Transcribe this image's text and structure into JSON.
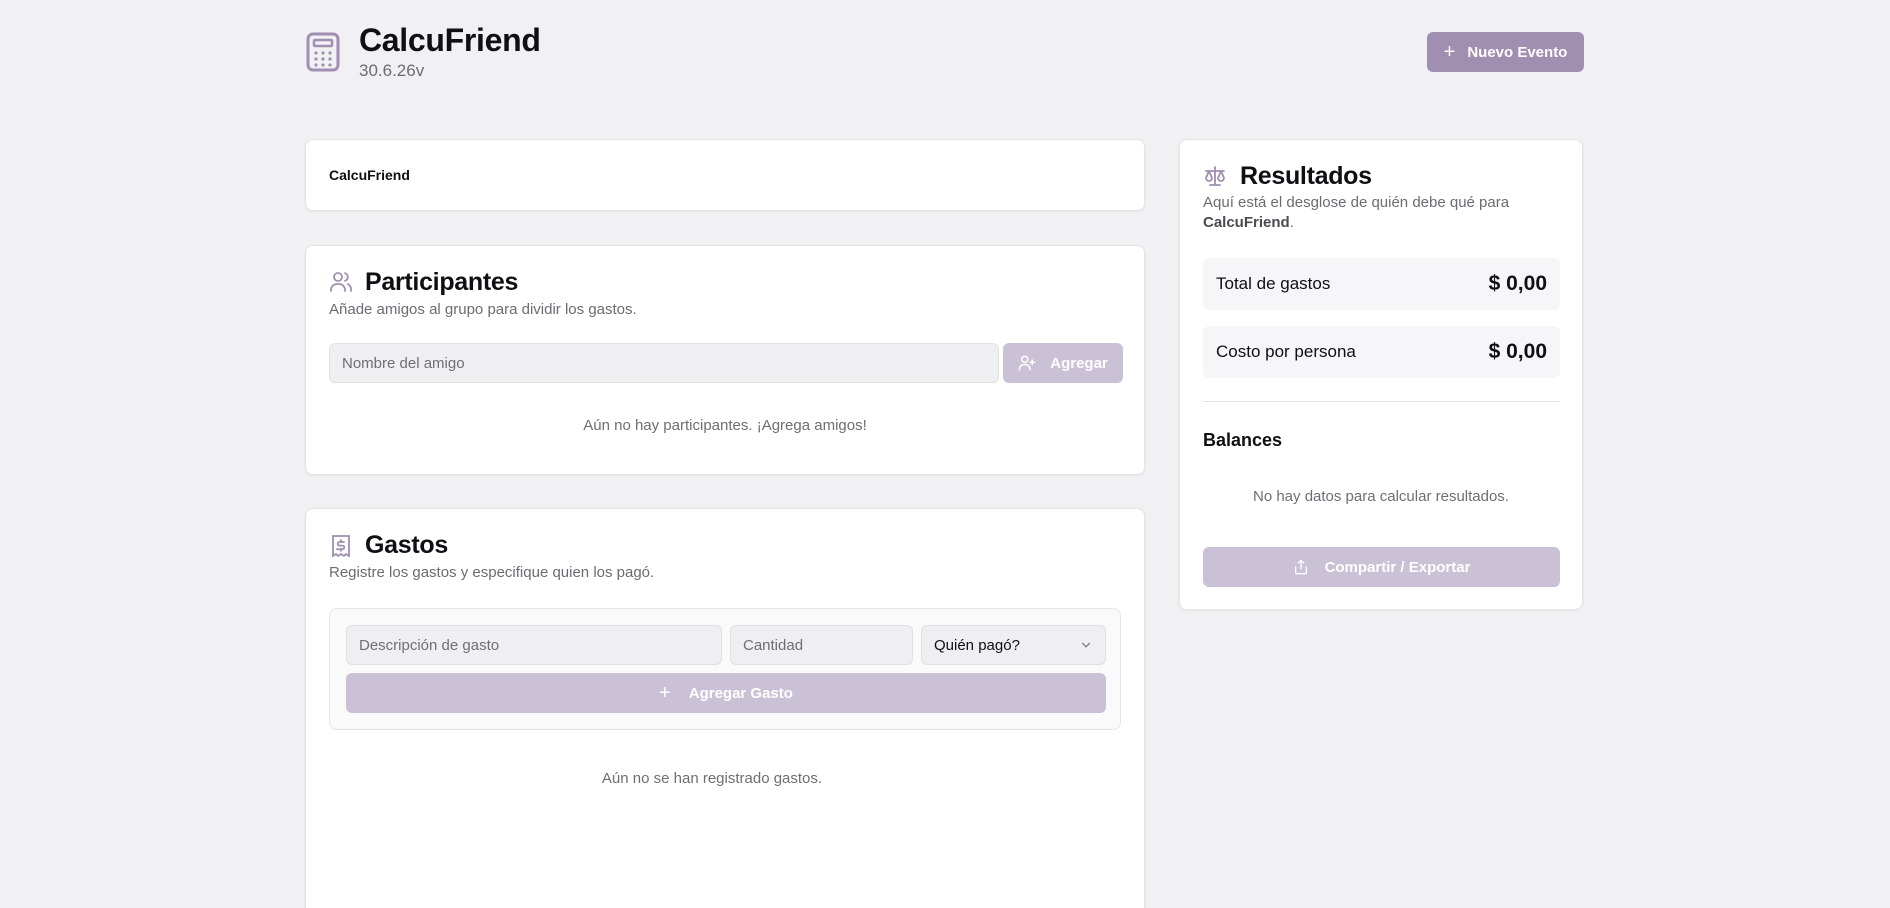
{
  "app": {
    "title": "CalcuFriend",
    "version": "30.6.26v",
    "new_event_label": "Nuevo Evento",
    "accent": "#a08fb0",
    "accent_disabled": "#cbc1d6"
  },
  "event": {
    "name": "CalcuFriend"
  },
  "participants": {
    "title": "Participantes",
    "subtitle": "Añade amigos al grupo para dividir los gastos.",
    "input_placeholder": "Nombre del amigo",
    "add_label": "Agregar",
    "empty": "Aún no hay participantes. ¡Agrega amigos!"
  },
  "expenses": {
    "title": "Gastos",
    "subtitle": "Registre los gastos y especifique quien los pagó.",
    "desc_placeholder": "Descripción de gasto",
    "qty_placeholder": "Cantidad",
    "payer_selected": "Quién pagó?",
    "add_label": "Agregar Gasto",
    "empty": "Aún no se han registrado gastos."
  },
  "results": {
    "title": "Resultados",
    "subtitle_prefix": "Aquí está el desglose de quién debe qué para",
    "subtitle_event": "CalcuFriend",
    "subtitle_suffix": ".",
    "total_label": "Total de gastos",
    "total_value": "$ 0,00",
    "per_person_label": "Costo por persona",
    "per_person_value": "$ 0,00",
    "balances_title": "Balances",
    "balances_empty": "No hay datos para calcular resultados.",
    "share_label": "Compartir / Exportar"
  }
}
